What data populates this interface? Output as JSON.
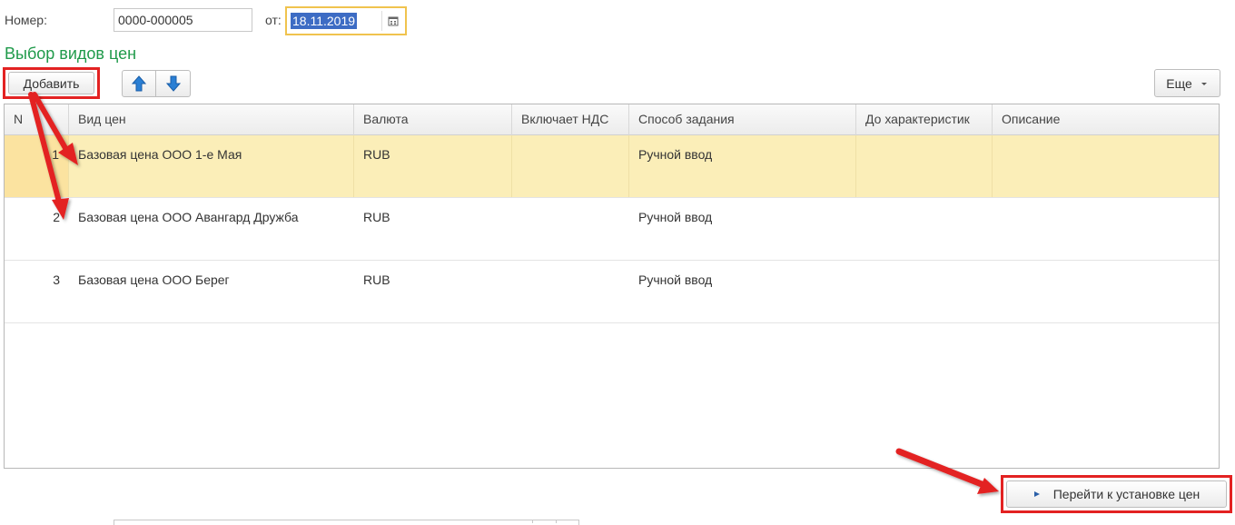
{
  "header": {
    "number_label": "Номер:",
    "number_value": "0000-000005",
    "date_label": "от:",
    "date_value": "18.11.2019"
  },
  "section_title": "Выбор видов цен",
  "toolbar": {
    "add_label": "Добавить",
    "more_label": "Еще"
  },
  "table": {
    "columns": [
      "N",
      "Вид цен",
      "Валюта",
      "Включает НДС",
      "Способ задания",
      "До характеристик",
      "Описание"
    ],
    "rows": [
      {
        "n": "1",
        "price_type": "Базовая цена ООО 1-е Мая",
        "currency": "RUB",
        "vat": "",
        "method": "Ручной ввод",
        "by_char": "",
        "desc": ""
      },
      {
        "n": "2",
        "price_type": "Базовая цена ООО Авангард Дружба",
        "currency": "RUB",
        "vat": "",
        "method": "Ручной ввод",
        "by_char": "",
        "desc": ""
      },
      {
        "n": "3",
        "price_type": "Базовая цена ООО Берег",
        "currency": "RUB",
        "vat": "",
        "method": "Ручной ввод",
        "by_char": "",
        "desc": ""
      }
    ]
  },
  "footer": {
    "go_label": "Перейти к установке цен"
  },
  "icons": {
    "up": "arrow-up-icon",
    "down": "arrow-down-icon",
    "calendar": "calendar-icon",
    "more": "chevron-down-icon",
    "go": "triangle-right-icon"
  },
  "colors": {
    "accent_green": "#1f9a4a",
    "selection": "#fbeeb8",
    "annotation_red": "#e32222",
    "arrow_blue": "#2a7fd4"
  }
}
